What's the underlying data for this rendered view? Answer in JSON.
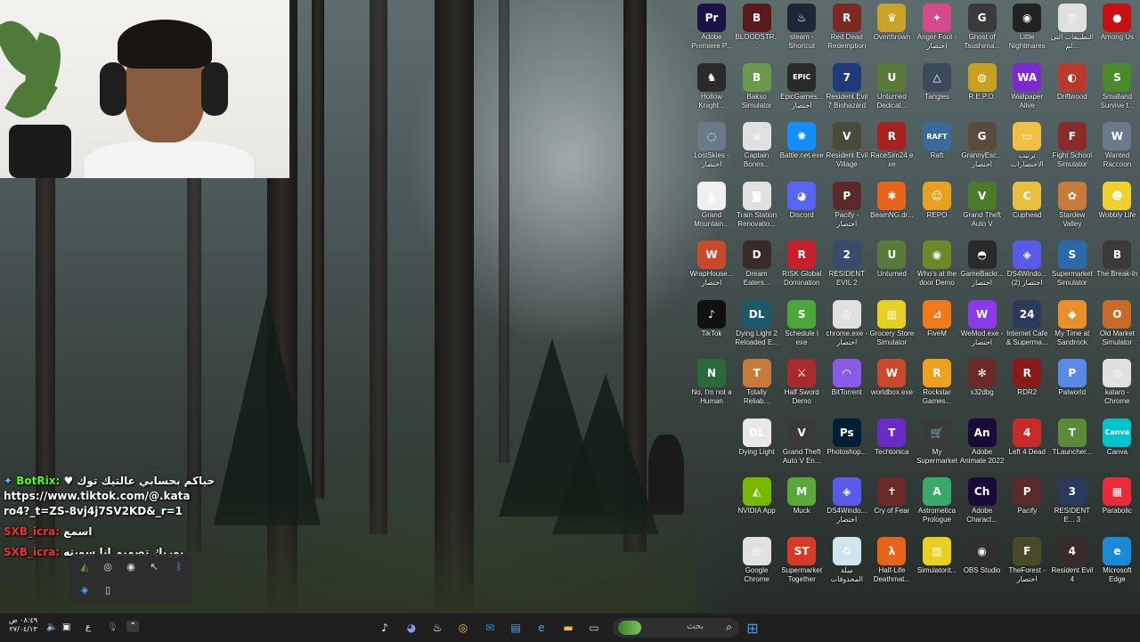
{
  "webcam": {
    "label": "streamer webcam"
  },
  "chat": {
    "lines": [
      {
        "user": "BotRix:",
        "text": "♥ حياكم بحسابي عالتيك توك"
      },
      {
        "link": "https://www.tiktok.com/@.kataro4?_t=ZS-8vj4j7SV2KD&_r=1"
      },
      {
        "user": "SXB_icra:",
        "text": "اسمع"
      },
      {
        "user": "SXB_icra:",
        "text": "بوريك تصميم انا سويته"
      }
    ]
  },
  "desktop_icons": [
    {
      "label": "Adobe Premiere P...",
      "glyph": "Pr",
      "color": "#1c1248"
    },
    {
      "label": "BLOODSTR...",
      "glyph": "B",
      "color": "#5a1a1a"
    },
    {
      "label": "steam - Shortcut",
      "glyph": "♨",
      "color": "#1b2838"
    },
    {
      "label": "Red Dead Redemption",
      "glyph": "R",
      "color": "#7a2a20"
    },
    {
      "label": "Overthrown",
      "glyph": "♛",
      "color": "#c9a227"
    },
    {
      "label": "Anger Foot - اختصار",
      "glyph": "✦",
      "color": "#d44a8a"
    },
    {
      "label": "Ghost of Tsushima...",
      "glyph": "G",
      "color": "#3a3a3a"
    },
    {
      "label": "Little Nightmares",
      "glyph": "◉",
      "color": "#222"
    },
    {
      "label": "التطبيقات التي لم...",
      "glyph": "◎",
      "color": "#e0e0e0"
    },
    {
      "label": "Among Us",
      "glyph": "●",
      "color": "#c51111"
    },
    {
      "label": "Hollow Knight...",
      "glyph": "♞",
      "color": "#2a2a2a"
    },
    {
      "label": "Bakso Simulator",
      "glyph": "B",
      "color": "#6a9a4a"
    },
    {
      "label": "EpicGames... اختصار",
      "glyph": "EPIC",
      "color": "#2a2a2a"
    },
    {
      "label": "Resident Evil 7 Biohazard",
      "glyph": "7",
      "color": "#1e3a7a"
    },
    {
      "label": "Unturned Dedicat...",
      "glyph": "U",
      "color": "#5a7a3a"
    },
    {
      "label": "Tangles",
      "glyph": "△",
      "color": "#3a4a5a"
    },
    {
      "label": "R.E.P.O.",
      "glyph": "◍",
      "color": "#c8a020"
    },
    {
      "label": "Wallpaper Alive",
      "glyph": "WA",
      "color": "#7a2ad0"
    },
    {
      "label": "Driftwood",
      "glyph": "◐",
      "color": "#b83a2a"
    },
    {
      "label": "Smalland Survive t...",
      "glyph": "S",
      "color": "#4a8a2a"
    },
    {
      "label": "LostSkies - اختصار",
      "glyph": "◌",
      "color": "#6a7a8a"
    },
    {
      "label": "Captain Bones...",
      "glyph": "☠",
      "color": "#e0e0e0"
    },
    {
      "label": "Battle.net.exe",
      "glyph": "✺",
      "color": "#148eff"
    },
    {
      "label": "Resident Evil Village",
      "glyph": "V",
      "color": "#4a4a3a"
    },
    {
      "label": "RaceSim24.exe",
      "glyph": "R",
      "color": "#a82020"
    },
    {
      "label": "Raft",
      "glyph": "RAFT",
      "color": "#3a6a9a"
    },
    {
      "label": "GrannyEsc... اختصار",
      "glyph": "G",
      "color": "#5a4a3a"
    },
    {
      "label": "ترتيب الاختصارات",
      "glyph": "▭",
      "color": "#f0c040"
    },
    {
      "label": "Fight School Simulator",
      "glyph": "F",
      "color": "#8a2a2a"
    },
    {
      "label": "Wanted Raccoon",
      "glyph": "W",
      "color": "#6a7a8a"
    },
    {
      "label": "Grand Mountain...",
      "glyph": "▲",
      "color": "#f0f0f0"
    },
    {
      "label": "Train Station Renovatio...",
      "glyph": "◙",
      "color": "#e0e0e0"
    },
    {
      "label": "Discord",
      "glyph": "◕",
      "color": "#5865f2"
    },
    {
      "label": "Pacify - اختصار",
      "glyph": "P",
      "color": "#5a2a2a"
    },
    {
      "label": "BeamNG.dr...",
      "glyph": "✱",
      "color": "#e8641a"
    },
    {
      "label": "REPO",
      "glyph": "☺",
      "color": "#e8a020"
    },
    {
      "label": "Grand Theft Auto V",
      "glyph": "V",
      "color": "#4a7a2a"
    },
    {
      "label": "Cuphead",
      "glyph": "C",
      "color": "#e8c040"
    },
    {
      "label": "Stardew Valley",
      "glyph": "✿",
      "color": "#c87a3a"
    },
    {
      "label": "Wobbly Life",
      "glyph": "☻",
      "color": "#f0d030"
    },
    {
      "label": "WrapHouse... اختصار",
      "glyph": "W",
      "color": "#c84a2a"
    },
    {
      "label": "Dream Eaters...",
      "glyph": "D",
      "color": "#3a2a2a"
    },
    {
      "label": "RISK Global Domination",
      "glyph": "R",
      "color": "#c8202a"
    },
    {
      "label": "RESIDENT EVIL 2",
      "glyph": "2",
      "color": "#3a4a6a"
    },
    {
      "label": "Unturned",
      "glyph": "U",
      "color": "#5a7a3a"
    },
    {
      "label": "Who's at the door Demo",
      "glyph": "◉",
      "color": "#6a8a2a"
    },
    {
      "label": "GameBackr... اختصار",
      "glyph": "◓",
      "color": "#2a2a2a"
    },
    {
      "label": "DS4Windo... (2) اختصار",
      "glyph": "◈",
      "color": "#5a5ae8"
    },
    {
      "label": "Supermarket Simulator",
      "glyph": "S",
      "color": "#2a6aa8"
    },
    {
      "label": "The Break-In",
      "glyph": "B",
      "color": "#3a3a3a"
    },
    {
      "label": "TikTok",
      "glyph": "♪",
      "color": "#111"
    },
    {
      "label": "Dying Light 2 Reloaded E...",
      "glyph": "DL",
      "color": "#1a5a6a"
    },
    {
      "label": "Schedule I exe",
      "glyph": "S",
      "color": "#4aa83a"
    },
    {
      "label": "chrome.exe - اختصار",
      "glyph": "◎",
      "color": "#e0e0e0"
    },
    {
      "label": "Grocery Store Simulator",
      "glyph": "▥",
      "color": "#e8d020"
    },
    {
      "label": "FiveM",
      "glyph": "⊿",
      "color": "#f07a1a"
    },
    {
      "label": "WeMod.exe - اختصار",
      "glyph": "W",
      "color": "#8a3ae8"
    },
    {
      "label": "Internet Cafe & Superma...",
      "glyph": "24",
      "color": "#2a3a5a"
    },
    {
      "label": "My Time at Sandrock",
      "glyph": "◆",
      "color": "#e8902a"
    },
    {
      "label": "Old Market Simulator",
      "glyph": "O",
      "color": "#c86a2a"
    },
    {
      "label": "No, I'm not a Human",
      "glyph": "N",
      "color": "#2a6a3a"
    },
    {
      "label": "Totally Reliab...",
      "glyph": "T",
      "color": "#c87a3a"
    },
    {
      "label": "Half Sword Demo",
      "glyph": "⚔",
      "color": "#a82a2a"
    },
    {
      "label": "BitTorrent",
      "glyph": "◠",
      "color": "#8a5ae8"
    },
    {
      "label": "worldbox.exe",
      "glyph": "W",
      "color": "#c84a2a"
    },
    {
      "label": "Rockstar Games...",
      "glyph": "R",
      "color": "#f0a020"
    },
    {
      "label": "x32dbg",
      "glyph": "✻",
      "color": "#6a2a2a"
    },
    {
      "label": "RDR2",
      "glyph": "R",
      "color": "#8a1a1a"
    },
    {
      "label": "Palworld",
      "glyph": "P",
      "color": "#5a8ae8"
    },
    {
      "label": "kataro - Chrome",
      "glyph": "◎",
      "color": "#e0e0e0"
    },
    {
      "label": "Dying Light",
      "glyph": "DL",
      "color": "#e8e8e8"
    },
    {
      "label": "Grand Theft Auto V En...",
      "glyph": "V",
      "color": "#3a3a3a"
    },
    {
      "label": "Photoshop...",
      "glyph": "Ps",
      "color": "#001e36"
    },
    {
      "label": "Techtonica",
      "glyph": "T",
      "color": "#6a2ac8"
    },
    {
      "label": "My Supermarket",
      "glyph": "🛒",
      "color": "#3a3a3a"
    },
    {
      "label": "Adobe Animate 2022",
      "glyph": "An",
      "color": "#1a0a3a"
    },
    {
      "label": "Left 4 Dead",
      "glyph": "4",
      "color": "#c82a2a"
    },
    {
      "label": "TLauncher...",
      "glyph": "T",
      "color": "#5a8a3a"
    },
    {
      "label": "Canva",
      "glyph": "Canva",
      "color": "#00c4cc"
    },
    {
      "label": "NVIDIA App",
      "glyph": "◭",
      "color": "#76b900"
    },
    {
      "label": "Muck",
      "glyph": "M",
      "color": "#5aa83a"
    },
    {
      "label": "DS4Windo... اختصار",
      "glyph": "◈",
      "color": "#5a5ae8"
    },
    {
      "label": "Cry of Fear",
      "glyph": "✝",
      "color": "#6a2a2a"
    },
    {
      "label": "Astrometica Prologue",
      "glyph": "A",
      "color": "#3aa86a"
    },
    {
      "label": "Adobe Charact...",
      "glyph": "Ch",
      "color": "#1a0a3a"
    },
    {
      "label": "Pacify",
      "glyph": "P",
      "color": "#5a2a2a"
    },
    {
      "label": "RESIDENT E... 3",
      "glyph": "3",
      "color": "#2a3a5a"
    },
    {
      "label": "Parabolic",
      "glyph": "▦",
      "color": "#e82a3a"
    },
    {
      "label": "Google Chrome",
      "glyph": "◎",
      "color": "#e0e0e0"
    },
    {
      "label": "Supermarket Together",
      "glyph": "ST",
      "color": "#d83a2a"
    },
    {
      "label": "سلة المحذوفات",
      "glyph": "♻",
      "color": "#cfe4f0"
    },
    {
      "label": "Half-Life Deathmat...",
      "glyph": "λ",
      "color": "#e8641a"
    },
    {
      "label": "Simulatorit...",
      "glyph": "▥",
      "color": "#e8d020"
    },
    {
      "label": "OBS Studio",
      "glyph": "◉",
      "color": "#302e31"
    },
    {
      "label": "TheForest - اختصار",
      "glyph": "F",
      "color": "#4a4a2a"
    },
    {
      "label": "Resident Evil 4",
      "glyph": "4",
      "color": "#3a2a2a"
    },
    {
      "label": "Microsoft Edge",
      "glyph": "e",
      "color": "#1a8ad8"
    }
  ],
  "taskbar": {
    "search_placeholder": "بحث",
    "clock_time": "٠٨:٤٩ ص",
    "clock_date": "٢٧/٠٤/١٣",
    "keyboard_lang": "ع",
    "apps": [
      "tiktok-icon",
      "discord-icon",
      "steam-icon",
      "chrome-icon",
      "outlook-icon",
      "store-icon",
      "edge-icon",
      "file-explorer-icon",
      "task-view-icon"
    ]
  }
}
